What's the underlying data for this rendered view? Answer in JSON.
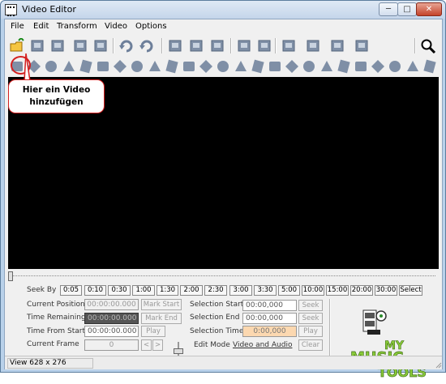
{
  "window": {
    "title": "Video Editor",
    "minimize_glyph": "─",
    "maximize_glyph": "□",
    "close_glyph": "✕"
  },
  "menu": [
    "File",
    "Edit",
    "Transform",
    "Video",
    "Options"
  ],
  "callout": {
    "line1": "Hier ein Video",
    "line2": "hinzufügen",
    "color": "#d42020"
  },
  "toolbar_row1_icons": [
    "open-file-icon",
    "add-clip-icon",
    "copy-icon",
    "film-icon",
    "paste-icon",
    "undo-icon",
    "redo-icon",
    "split-icon",
    "cut-frame-icon",
    "delete-icon",
    "merge-icon",
    "trim-icon",
    "crop-icon",
    "rotate-icon",
    "resize-icon",
    "text-effect-icon",
    "zoom-icon"
  ],
  "toolbar_row2_icons": [
    "effect-1-icon",
    "effect-2-icon",
    "effect-3-icon",
    "effect-4-icon",
    "effect-5-icon",
    "effect-6-icon",
    "effect-7-icon",
    "effect-8-icon",
    "effect-9-icon",
    "effect-10-icon",
    "effect-11-icon",
    "effect-12-icon",
    "effect-13-icon",
    "effect-14-icon",
    "effect-15-icon",
    "effect-16-icon",
    "effect-17-icon",
    "effect-18-icon",
    "effect-19-icon",
    "effect-20-icon",
    "effect-21-icon",
    "effect-22-icon",
    "effect-23-icon",
    "effect-24-icon",
    "effect-25-icon"
  ],
  "seek": {
    "label": "Seek By",
    "buttons": [
      "0:05",
      "0:10",
      "0:30",
      "1:00",
      "1:30",
      "2:00",
      "2:30",
      "3:00",
      "3:30",
      "5:00",
      "10:00",
      "15:00",
      "20:00",
      "30:00",
      "Select"
    ]
  },
  "position": {
    "current_position_label": "Current Position",
    "current_position_value": "00:00:00.000",
    "mark_start": "Mark Start",
    "time_remaining_label": "Time Remaining",
    "time_remaining_value": "00:00:00.000",
    "mark_end": "Mark End",
    "time_from_start_label": "Time From Start",
    "time_from_start_value": "00:00:00.000",
    "play": "Play",
    "current_frame_label": "Current Frame",
    "current_frame_value": "0",
    "prev": "<",
    "next": ">"
  },
  "selection": {
    "start_label": "Selection Start",
    "start_value": "00:00,000",
    "seek1": "Seek",
    "end_label": "Selection End",
    "end_value": "00:00,000",
    "seek2": "Seek",
    "time_label": "Selection Time",
    "time_value": "0:00,000",
    "play": "Play",
    "edit_mode_label": "Edit Mode",
    "edit_mode_value": "Video and Audio",
    "clear": "Clear"
  },
  "status": {
    "view": "View 628 x 276"
  },
  "logo": {
    "line1": "MY",
    "line2": "MUSIC",
    "line3": "TOOLS"
  }
}
